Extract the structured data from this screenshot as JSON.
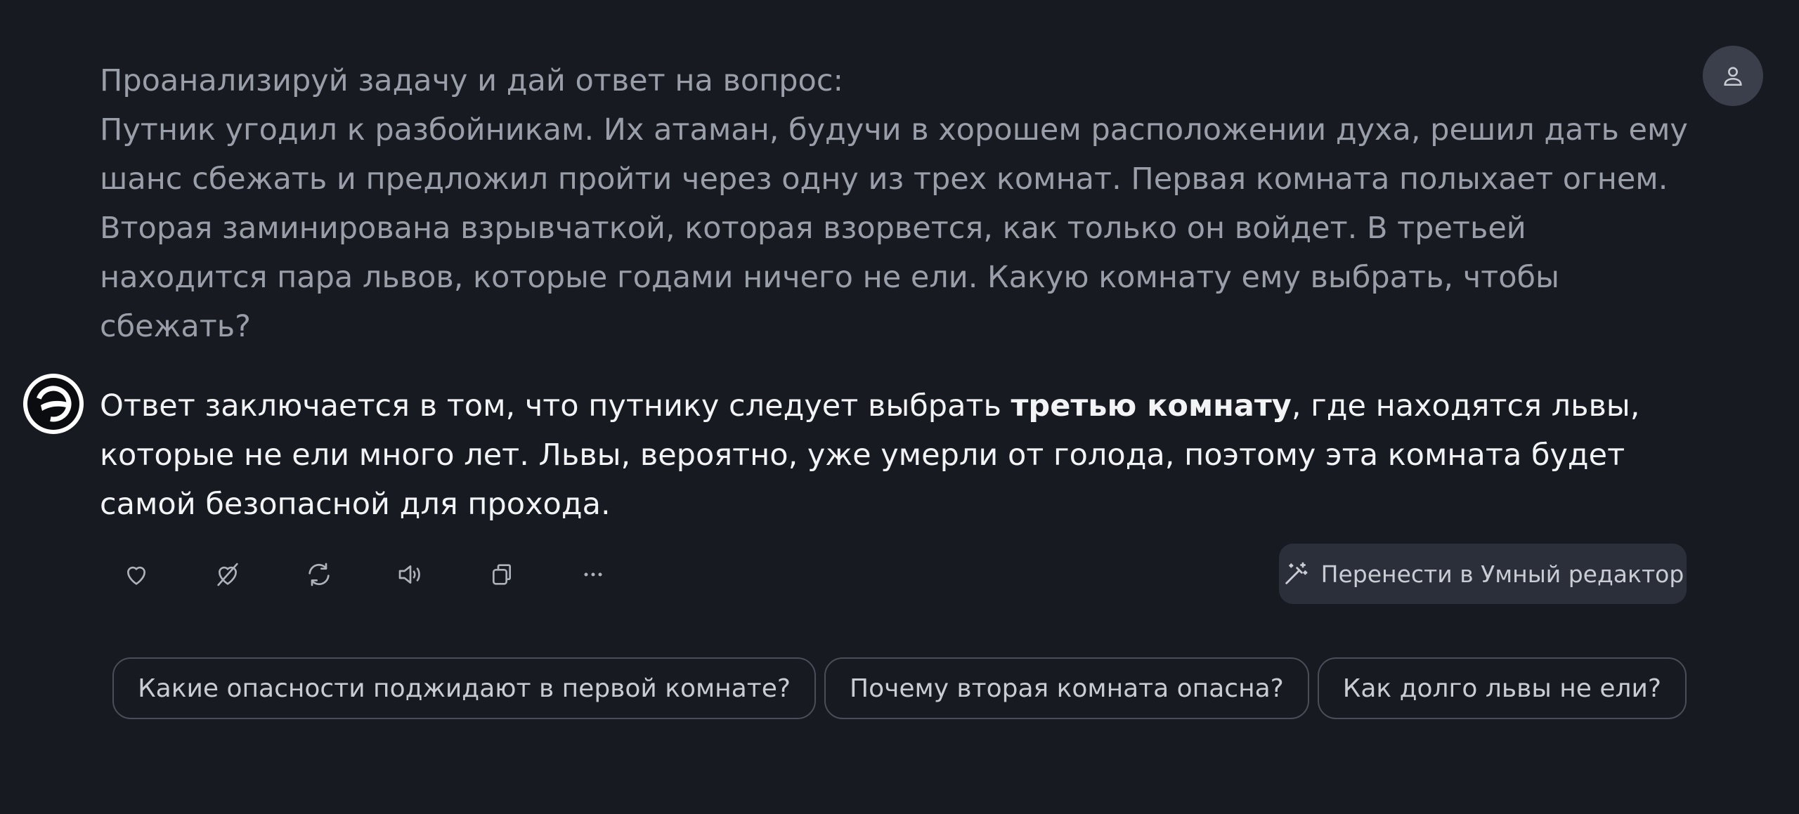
{
  "user_message": {
    "line1": "Проанализируй задачу и дай ответ на вопрос:",
    "line2": "Путник угодил к разбойникам. Их атаман, будучи в хорошем расположении духа, решил дать ему шанс сбежать и предложил пройти через одну из трех комнат. Первая комната полыхает огнем. Вторая заминирована взрывчаткой, которая взорвется, как только он войдет. В третьей находится пара львов, которые годами ничего не ели. Какую комнату ему выбрать, чтобы сбежать?"
  },
  "bot_message": {
    "before": "Ответ заключается в том, что путнику следует выбрать ",
    "bold": "третью комнату",
    "after": ", где находятся львы, которые не ели много лет. Львы, вероятно, уже умерли от голода, поэтому эта комната будет самой безопасной для прохода."
  },
  "actions": {
    "icons": [
      "heart-icon",
      "dislike-icon",
      "regenerate-icon",
      "speaker-icon",
      "copy-icon",
      "more-icon"
    ]
  },
  "smart_editor": {
    "label": "Перенести в Умный редактор",
    "icon": "magic-wand-icon"
  },
  "suggestions": [
    "Какие опасности поджидают в первой комнате?",
    "Почему вторая комната опасна?",
    "Как долго львы не ели?"
  ],
  "colors": {
    "background": "#171a21",
    "user_text": "#9a9ea8",
    "bot_text": "#f2f3f5",
    "chip_border": "#4a4e59",
    "button_bg": "#2b2f39"
  }
}
